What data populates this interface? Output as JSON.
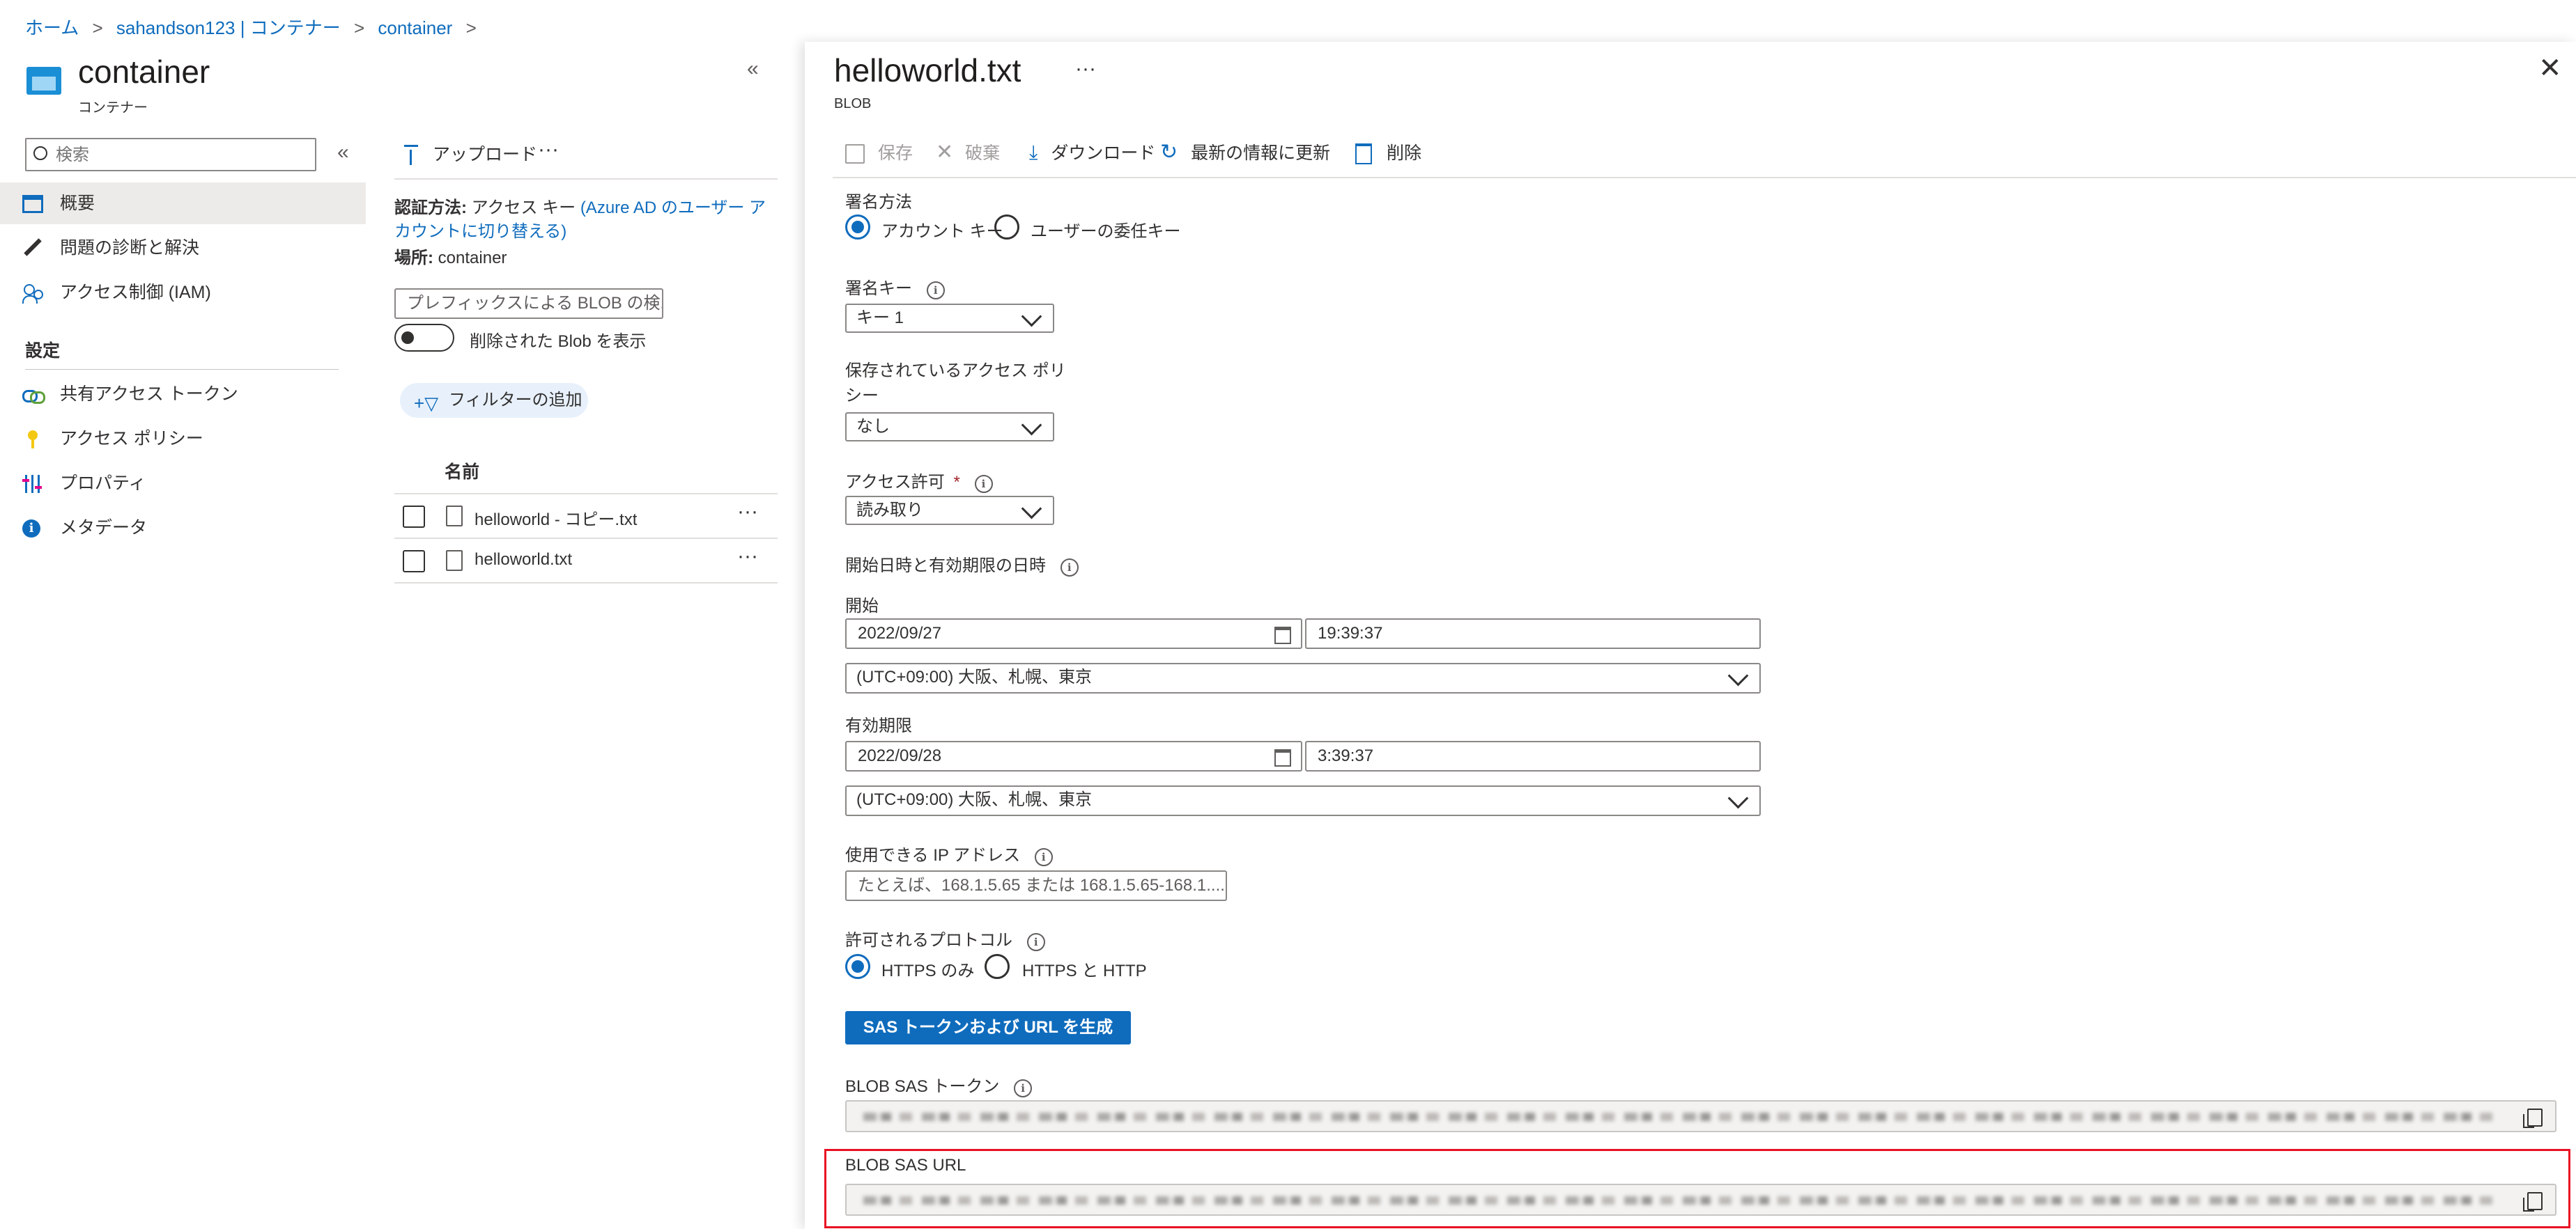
{
  "breadcrumb": [
    "ホーム",
    "sahandson123 | コンテナー",
    "container"
  ],
  "blade": {
    "title": "container",
    "subtitle": "コンテナー"
  },
  "sidebar": {
    "search_placeholder": "検索",
    "items": [
      {
        "label": "概要",
        "icon": "overview-icon",
        "selected": true
      },
      {
        "label": "問題の診断と解決",
        "icon": "wrench-icon"
      },
      {
        "label": "アクセス制御 (IAM)",
        "icon": "people-icon"
      }
    ],
    "section_settings": "設定",
    "settings_items": [
      {
        "label": "共有アクセス トークン",
        "icon": "link-icon"
      },
      {
        "label": "アクセス ポリシー",
        "icon": "key-icon"
      },
      {
        "label": "プロパティ",
        "icon": "properties-icon"
      },
      {
        "label": "メタデータ",
        "icon": "info-icon"
      }
    ]
  },
  "list": {
    "upload": "アップロード",
    "more": "···",
    "auth_label": "認証方法:",
    "auth_value": "アクセス キー",
    "auth_link": "(Azure AD のユーザー アカウントに切り替える)",
    "location_label": "場所:",
    "location_value": "container",
    "prefix_placeholder": "プレフィックスによる BLOB の検...",
    "show_deleted": "削除された Blob を表示",
    "add_filter": "フィルターの追加",
    "col_name": "名前",
    "rows": [
      {
        "name": "helloworld - コピー.txt"
      },
      {
        "name": "helloworld.txt"
      }
    ]
  },
  "panel": {
    "title": "helloworld.txt",
    "more": "···",
    "subtitle": "BLOB",
    "toolbar": {
      "save": "保存",
      "discard": "破棄",
      "download": "ダウンロード",
      "refresh": "最新の情報に更新",
      "delete": "削除"
    },
    "signing_method": {
      "label": "署名方法",
      "option_account": "アカウント キー",
      "option_user": "ユーザーの委任キー",
      "selected": "アカウント キー"
    },
    "signing_key": {
      "label": "署名キー",
      "value": "キー 1"
    },
    "stored_policy": {
      "label_line1": "保存されているアクセス ポリ",
      "label_line2": "シー",
      "value": "なし"
    },
    "permissions": {
      "label": "アクセス許可",
      "required_mark": "*",
      "value": "読み取り"
    },
    "datetime_label": "開始日時と有効期限の日時",
    "start": {
      "label": "開始",
      "date": "2022/09/27",
      "time": "19:39:37",
      "timezone": "(UTC+09:00) 大阪、札幌、東京"
    },
    "expiry": {
      "label": "有効期限",
      "date": "2022/09/28",
      "time": "3:39:37",
      "timezone": "(UTC+09:00) 大阪、札幌、東京"
    },
    "ip": {
      "label": "使用できる IP アドレス",
      "placeholder": "たとえば、168.1.5.65 または 168.1.5.65-168.1...."
    },
    "protocol": {
      "label": "許可されるプロトコル",
      "option_https": "HTTPS のみ",
      "option_both": "HTTPS と HTTP",
      "selected": "HTTPS のみ"
    },
    "generate_button": "SAS トークンおよび URL を生成",
    "sas_token_label": "BLOB SAS トークン",
    "sas_url_label": "BLOB SAS URL"
  },
  "colors": {
    "accent": "#0f6cbd",
    "highlight": "#e81123",
    "selected_bg": "#edebe9"
  }
}
